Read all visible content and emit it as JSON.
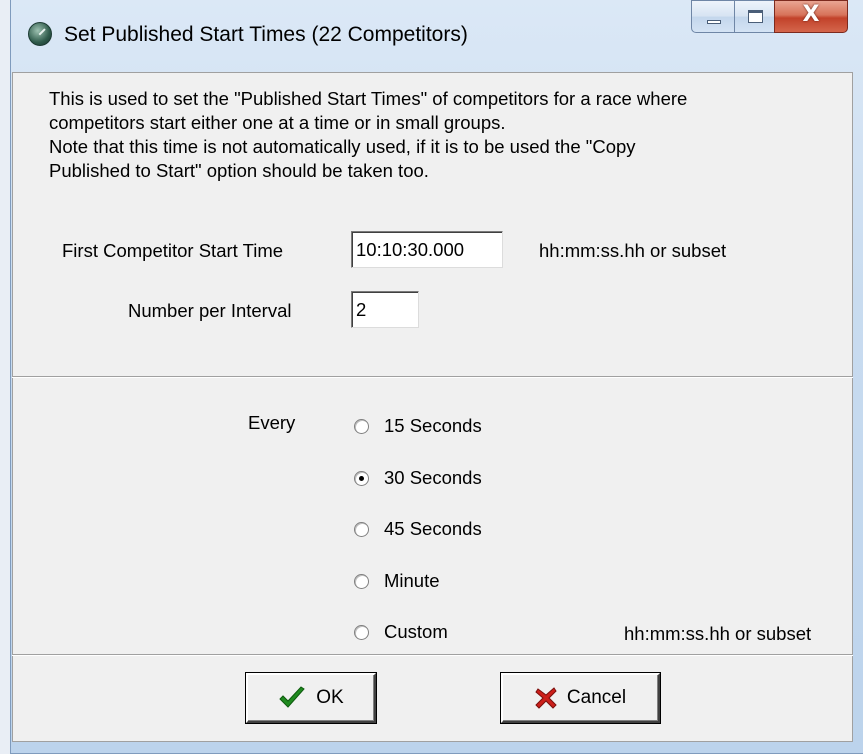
{
  "window": {
    "title": "Set Published Start Times (22 Competitors)",
    "icon": "clock-icon",
    "close_glyph": "X"
  },
  "description": {
    "line1": "This is used to set the \"Published Start Times\" of competitors for a race where",
    "line2": "competitors start either one at a time or in small groups.",
    "line3": "Note that this time is not automatically used, if it is to be used the \"Copy",
    "line4": "Published to Start\" option should be taken too."
  },
  "start_time": {
    "label": "First Competitor Start Time",
    "value": "10:10:30.000",
    "hint": "hh:mm:ss.hh or subset"
  },
  "interval": {
    "label": "Number per Interval",
    "value": "2"
  },
  "every": {
    "label": "Every",
    "options": [
      {
        "label": "15 Seconds",
        "checked": false
      },
      {
        "label": "30 Seconds",
        "checked": true
      },
      {
        "label": "45 Seconds",
        "checked": false
      },
      {
        "label": "Minute",
        "checked": false
      },
      {
        "label": "Custom",
        "checked": false
      }
    ],
    "custom_hint": "hh:mm:ss.hh or subset"
  },
  "buttons": {
    "ok": "OK",
    "cancel": "Cancel"
  },
  "colors": {
    "ok_check": "#1f8a1f",
    "cancel_x": "#cc1f1a"
  }
}
